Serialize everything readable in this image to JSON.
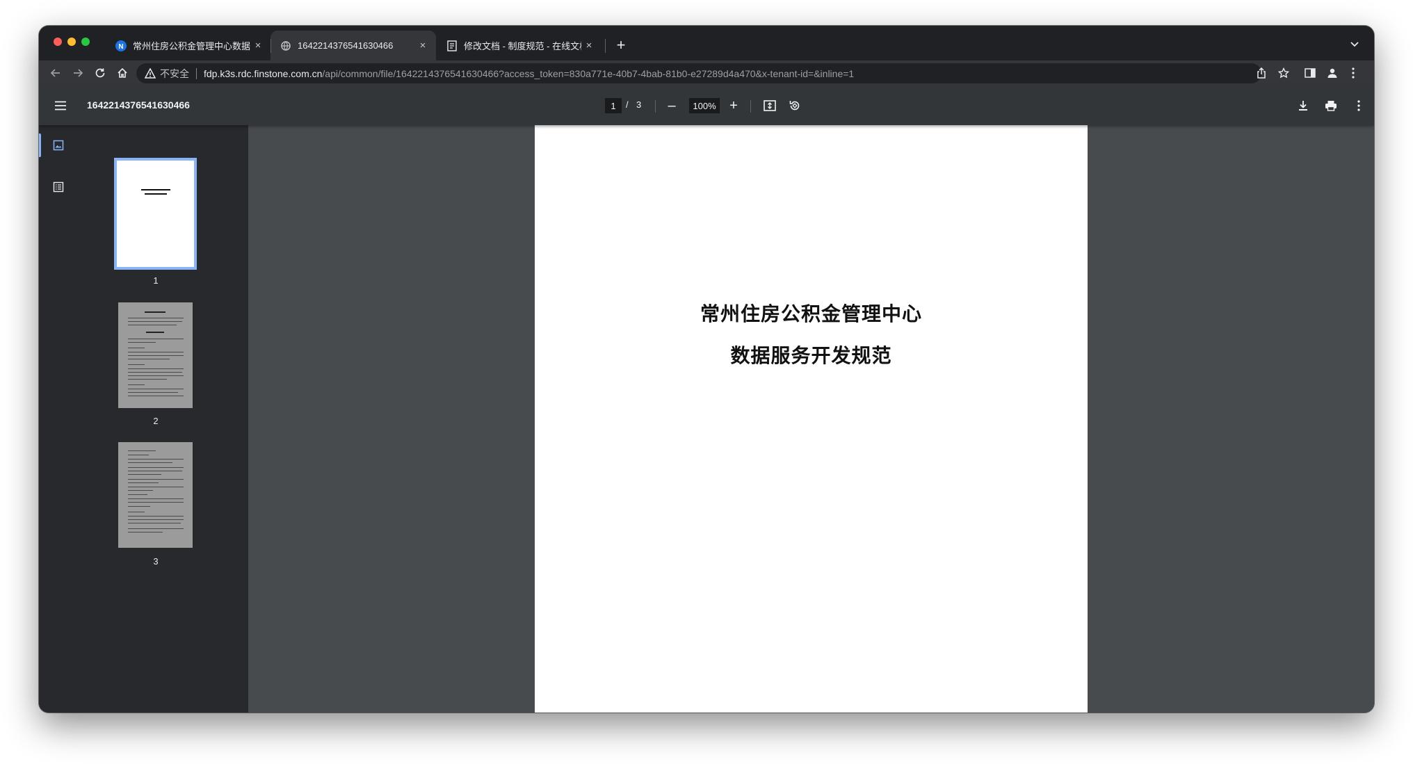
{
  "tabs": [
    {
      "title": "常州住房公积金管理中心数据管理",
      "favicon": "n-logo-icon",
      "active": false
    },
    {
      "title": "16422143765416 30466",
      "favicon": "globe-icon",
      "active": true
    },
    {
      "title": "修改文档 - 制度规范 - 在线文档",
      "favicon": "doc-icon",
      "active": false
    }
  ],
  "tab_close": "×",
  "new_tab": "+",
  "address": {
    "insecure_label": "不安全",
    "url_host": "fdp.k3s.rdc.finstone.com.cn",
    "url_path": "/api/common/file/1642214376541630466?access_token=830a771e-40b7-4bab-81b0-e27289d4a470&x-tenant-id=&inline=1"
  },
  "pdf": {
    "file_name": "1642214376541630466",
    "current_page": "1",
    "page_sep": "/",
    "total_pages": "3",
    "zoom": "100%",
    "zoom_out": "–",
    "zoom_in": "+"
  },
  "thumbnails": [
    {
      "label": "1",
      "selected": true
    },
    {
      "label": "2",
      "selected": false
    },
    {
      "label": "3",
      "selected": false
    }
  ],
  "document": {
    "title_line1": "常州住房公积金管理中心",
    "title_line2": "数据服务开发规范"
  },
  "colors": {
    "accent": "#8ab4f8",
    "frame": "#202124",
    "toolbar": "#35363a",
    "pdf_toolbar": "#323639",
    "sidebar": "#28292c",
    "canvas": "#484b4e"
  }
}
